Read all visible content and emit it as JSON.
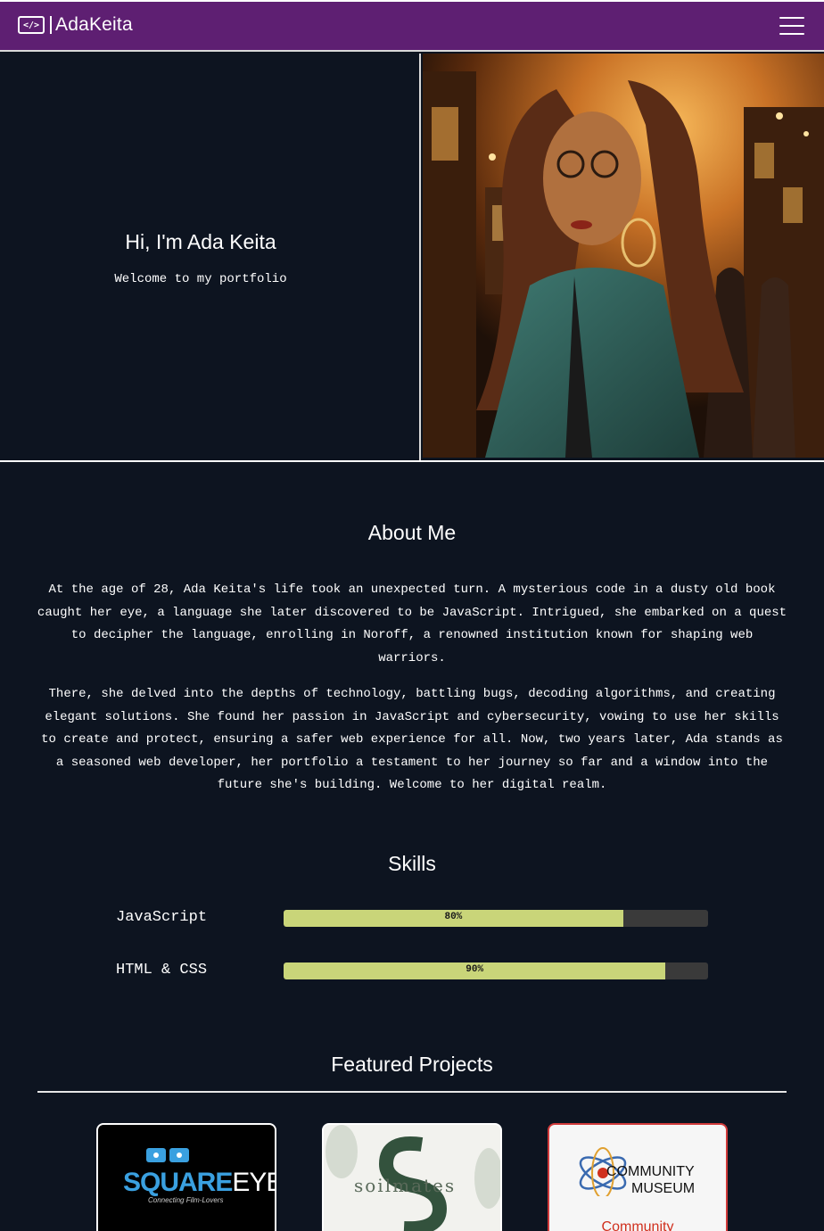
{
  "nav": {
    "brand": "AdaKeita",
    "logo_glyph": "</>",
    "menu_icon": "hamburger-menu-icon"
  },
  "hero": {
    "title": "Hi, I'm Ada Keita",
    "subtitle": "Welcome to my portfolio"
  },
  "about": {
    "title": "About Me",
    "paragraphs": [
      "At the age of 28, Ada Keita's life took an unexpected turn. A mysterious code in a dusty old book caught her eye, a language she later discovered to be JavaScript. Intrigued, she embarked on a quest to decipher the language, enrolling in Noroff, a renowned institution known for shaping web warriors.",
      "There, she delved into the depths of technology, battling bugs, decoding algorithms, and creating elegant solutions. She found her passion in JavaScript and cybersecurity, vowing to use her skills to create and protect, ensuring a safer web experience for all. Now, two years later, Ada stands as a seasoned web developer, her portfolio a testament to her journey so far and a window into the future she's building. Welcome to her digital realm."
    ]
  },
  "skills": {
    "title": "Skills",
    "items": [
      {
        "label": "JavaScript",
        "percent_label": "80%",
        "percent": 80
      },
      {
        "label": "HTML & CSS",
        "percent_label": "90%",
        "percent": 90
      }
    ]
  },
  "projects": {
    "title": "Featured Projects",
    "cards": [
      {
        "logo_a": "SQUARE",
        "logo_b": "EYES",
        "tagline": "Connecting Film-Lovers"
      },
      {
        "logo": "soilmates"
      },
      {
        "logo_line1": "COMMUNITY",
        "logo_line2": "MUSEUM",
        "caption": "Community"
      }
    ]
  },
  "colors": {
    "nav_bg": "#5e1f72",
    "page_bg": "#0d1420",
    "skill_fill": "#c9d579",
    "skill_track": "#3a3a3a",
    "accent_blue": "#3aa0e0",
    "accent_red": "#d0301e"
  }
}
